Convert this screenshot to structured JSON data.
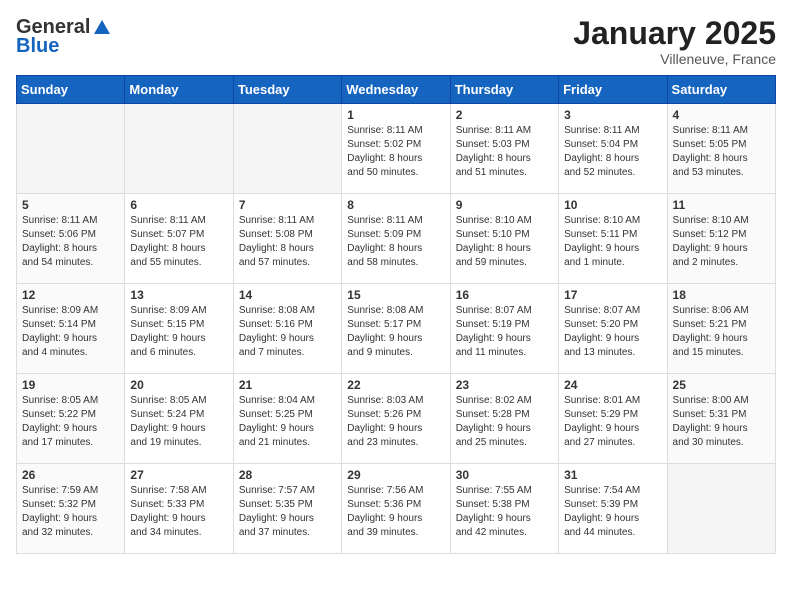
{
  "header": {
    "logo_general": "General",
    "logo_blue": "Blue",
    "month_title": "January 2025",
    "location": "Villeneuve, France"
  },
  "weekdays": [
    "Sunday",
    "Monday",
    "Tuesday",
    "Wednesday",
    "Thursday",
    "Friday",
    "Saturday"
  ],
  "weeks": [
    [
      {
        "day": "",
        "info": ""
      },
      {
        "day": "",
        "info": ""
      },
      {
        "day": "",
        "info": ""
      },
      {
        "day": "1",
        "info": "Sunrise: 8:11 AM\nSunset: 5:02 PM\nDaylight: 8 hours\nand 50 minutes."
      },
      {
        "day": "2",
        "info": "Sunrise: 8:11 AM\nSunset: 5:03 PM\nDaylight: 8 hours\nand 51 minutes."
      },
      {
        "day": "3",
        "info": "Sunrise: 8:11 AM\nSunset: 5:04 PM\nDaylight: 8 hours\nand 52 minutes."
      },
      {
        "day": "4",
        "info": "Sunrise: 8:11 AM\nSunset: 5:05 PM\nDaylight: 8 hours\nand 53 minutes."
      }
    ],
    [
      {
        "day": "5",
        "info": "Sunrise: 8:11 AM\nSunset: 5:06 PM\nDaylight: 8 hours\nand 54 minutes."
      },
      {
        "day": "6",
        "info": "Sunrise: 8:11 AM\nSunset: 5:07 PM\nDaylight: 8 hours\nand 55 minutes."
      },
      {
        "day": "7",
        "info": "Sunrise: 8:11 AM\nSunset: 5:08 PM\nDaylight: 8 hours\nand 57 minutes."
      },
      {
        "day": "8",
        "info": "Sunrise: 8:11 AM\nSunset: 5:09 PM\nDaylight: 8 hours\nand 58 minutes."
      },
      {
        "day": "9",
        "info": "Sunrise: 8:10 AM\nSunset: 5:10 PM\nDaylight: 8 hours\nand 59 minutes."
      },
      {
        "day": "10",
        "info": "Sunrise: 8:10 AM\nSunset: 5:11 PM\nDaylight: 9 hours\nand 1 minute."
      },
      {
        "day": "11",
        "info": "Sunrise: 8:10 AM\nSunset: 5:12 PM\nDaylight: 9 hours\nand 2 minutes."
      }
    ],
    [
      {
        "day": "12",
        "info": "Sunrise: 8:09 AM\nSunset: 5:14 PM\nDaylight: 9 hours\nand 4 minutes."
      },
      {
        "day": "13",
        "info": "Sunrise: 8:09 AM\nSunset: 5:15 PM\nDaylight: 9 hours\nand 6 minutes."
      },
      {
        "day": "14",
        "info": "Sunrise: 8:08 AM\nSunset: 5:16 PM\nDaylight: 9 hours\nand 7 minutes."
      },
      {
        "day": "15",
        "info": "Sunrise: 8:08 AM\nSunset: 5:17 PM\nDaylight: 9 hours\nand 9 minutes."
      },
      {
        "day": "16",
        "info": "Sunrise: 8:07 AM\nSunset: 5:19 PM\nDaylight: 9 hours\nand 11 minutes."
      },
      {
        "day": "17",
        "info": "Sunrise: 8:07 AM\nSunset: 5:20 PM\nDaylight: 9 hours\nand 13 minutes."
      },
      {
        "day": "18",
        "info": "Sunrise: 8:06 AM\nSunset: 5:21 PM\nDaylight: 9 hours\nand 15 minutes."
      }
    ],
    [
      {
        "day": "19",
        "info": "Sunrise: 8:05 AM\nSunset: 5:22 PM\nDaylight: 9 hours\nand 17 minutes."
      },
      {
        "day": "20",
        "info": "Sunrise: 8:05 AM\nSunset: 5:24 PM\nDaylight: 9 hours\nand 19 minutes."
      },
      {
        "day": "21",
        "info": "Sunrise: 8:04 AM\nSunset: 5:25 PM\nDaylight: 9 hours\nand 21 minutes."
      },
      {
        "day": "22",
        "info": "Sunrise: 8:03 AM\nSunset: 5:26 PM\nDaylight: 9 hours\nand 23 minutes."
      },
      {
        "day": "23",
        "info": "Sunrise: 8:02 AM\nSunset: 5:28 PM\nDaylight: 9 hours\nand 25 minutes."
      },
      {
        "day": "24",
        "info": "Sunrise: 8:01 AM\nSunset: 5:29 PM\nDaylight: 9 hours\nand 27 minutes."
      },
      {
        "day": "25",
        "info": "Sunrise: 8:00 AM\nSunset: 5:31 PM\nDaylight: 9 hours\nand 30 minutes."
      }
    ],
    [
      {
        "day": "26",
        "info": "Sunrise: 7:59 AM\nSunset: 5:32 PM\nDaylight: 9 hours\nand 32 minutes."
      },
      {
        "day": "27",
        "info": "Sunrise: 7:58 AM\nSunset: 5:33 PM\nDaylight: 9 hours\nand 34 minutes."
      },
      {
        "day": "28",
        "info": "Sunrise: 7:57 AM\nSunset: 5:35 PM\nDaylight: 9 hours\nand 37 minutes."
      },
      {
        "day": "29",
        "info": "Sunrise: 7:56 AM\nSunset: 5:36 PM\nDaylight: 9 hours\nand 39 minutes."
      },
      {
        "day": "30",
        "info": "Sunrise: 7:55 AM\nSunset: 5:38 PM\nDaylight: 9 hours\nand 42 minutes."
      },
      {
        "day": "31",
        "info": "Sunrise: 7:54 AM\nSunset: 5:39 PM\nDaylight: 9 hours\nand 44 minutes."
      },
      {
        "day": "",
        "info": ""
      }
    ]
  ]
}
